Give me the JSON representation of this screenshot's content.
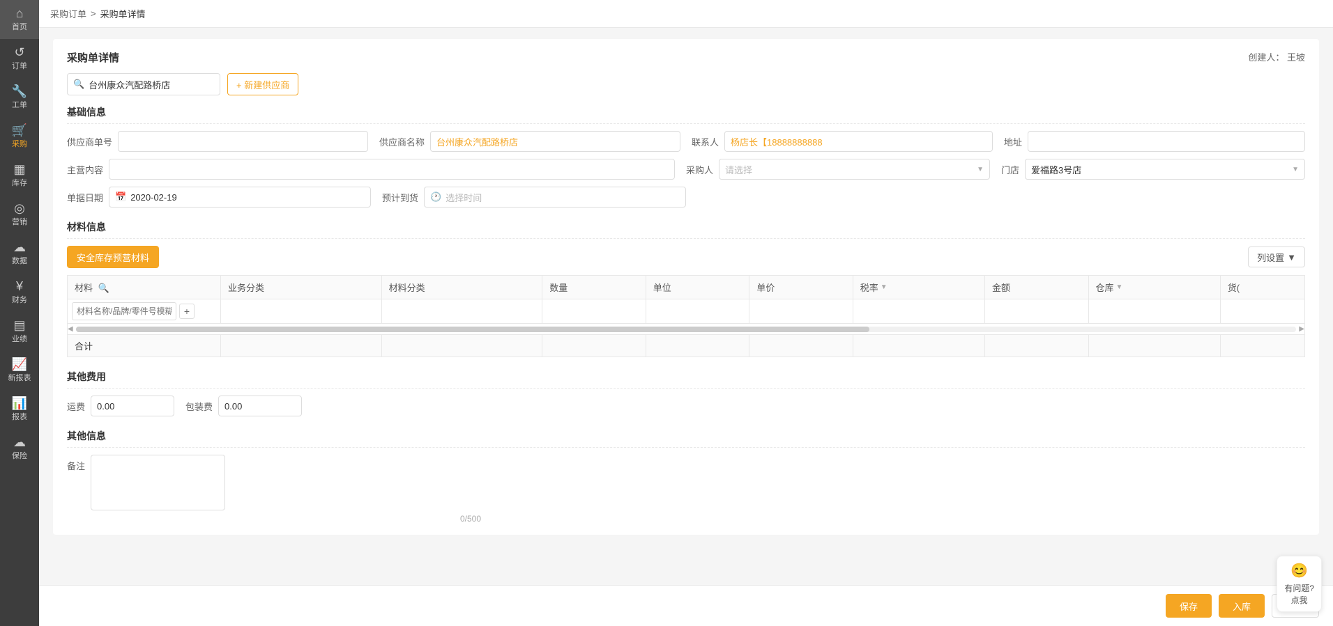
{
  "sidebar": {
    "items": [
      {
        "id": "home",
        "icon": "⌂",
        "label": "首页",
        "active": false
      },
      {
        "id": "orders",
        "icon": "↺",
        "label": "订单",
        "active": false
      },
      {
        "id": "tools",
        "icon": "🔧",
        "label": "工单",
        "active": false
      },
      {
        "id": "purchase",
        "icon": "🛒",
        "label": "采购",
        "active": true
      },
      {
        "id": "inventory",
        "icon": "▦",
        "label": "库存",
        "active": false
      },
      {
        "id": "marketing",
        "icon": "◎",
        "label": "营销",
        "active": false
      },
      {
        "id": "data",
        "icon": "☁",
        "label": "数据",
        "active": false
      },
      {
        "id": "finance",
        "icon": "¥",
        "label": "财务",
        "active": false
      },
      {
        "id": "performance",
        "icon": "▤",
        "label": "业绩",
        "active": false
      },
      {
        "id": "newreport",
        "icon": "📈",
        "label": "新报表",
        "active": false
      },
      {
        "id": "report",
        "icon": "📊",
        "label": "报表",
        "active": false
      },
      {
        "id": "insurance",
        "icon": "☁",
        "label": "保险",
        "active": false
      }
    ]
  },
  "breadcrumb": {
    "parent": "采购订单",
    "current": "采购单详情",
    "separator": ">"
  },
  "page": {
    "title": "采购单详情",
    "creator_label": "创建人：",
    "creator_name": "王坡"
  },
  "supplier_search": {
    "value": "台州康众汽配路桥店",
    "placeholder": "台州康众汽配路桥店",
    "add_button_label": "+ 新建供应商"
  },
  "basic_info": {
    "section_title": "基础信息",
    "fields": {
      "supplier_no_label": "供应商单号",
      "supplier_no_value": "",
      "supplier_name_label": "供应商名称",
      "supplier_name_value": "台州康众汽配路桥店",
      "contact_label": "联系人",
      "contact_value": "杨店长【18888888888",
      "address_label": "地址",
      "address_value": "",
      "main_content_label": "主营内容",
      "main_content_value": "",
      "buyer_label": "采购人",
      "buyer_placeholder": "请选择",
      "store_label": "门店",
      "store_value": "爱福路3号店",
      "date_label": "单据日期",
      "date_value": "2020-02-19",
      "expected_date_label": "预计到货",
      "expected_date_placeholder": "选择时间"
    }
  },
  "materials": {
    "section_title": "材料信息",
    "safety_stock_btn": "安全库存预营材料",
    "col_settings_btn": "列设置",
    "columns": [
      {
        "id": "material",
        "label": "材料"
      },
      {
        "id": "biz_category",
        "label": "业务分类"
      },
      {
        "id": "material_category",
        "label": "材料分类"
      },
      {
        "id": "quantity",
        "label": "数量"
      },
      {
        "id": "unit",
        "label": "单位"
      },
      {
        "id": "unit_price",
        "label": "单价"
      },
      {
        "id": "tax_rate",
        "label": "税率",
        "has_filter": true
      },
      {
        "id": "amount",
        "label": "金额"
      },
      {
        "id": "warehouse",
        "label": "仓库",
        "has_dropdown": true
      },
      {
        "id": "cargo",
        "label": "货("
      }
    ],
    "search_placeholder": "材料名称/品牌/零件号模糊查询",
    "subtotal_label": "合计"
  },
  "other_fees": {
    "section_title": "其他费用",
    "shipping_label": "运费",
    "shipping_value": "0.00",
    "packaging_label": "包装费",
    "packaging_value": "0.00"
  },
  "other_info": {
    "section_title": "其他信息",
    "remark_label": "备注",
    "remark_value": "",
    "remark_count": "0/500"
  },
  "footer": {
    "save_label": "保存",
    "instock_label": "入库",
    "return_label": "返回"
  },
  "help": {
    "icon": "😊",
    "text": "有问题?\n点我"
  }
}
